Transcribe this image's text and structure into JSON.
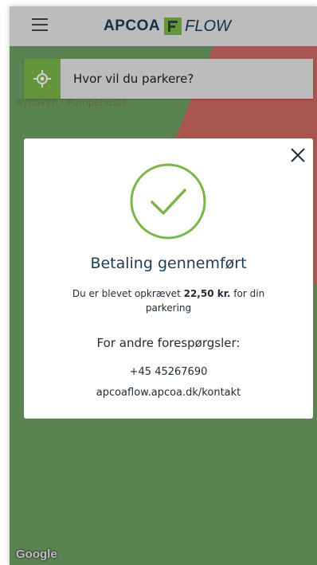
{
  "header": {
    "brand_left": "APCOA",
    "brand_right": "FLOW",
    "menu_icon": "hamburger-menu-icon",
    "brand_color": "#7ab648"
  },
  "search": {
    "placeholder": "Hvor vil du parkere?",
    "icon": "locate-crosshair-icon"
  },
  "map": {
    "street_label": "Byhaven - Pumpehuset",
    "attribution": "Google",
    "zone_colors": {
      "green": "#6f9f63",
      "red": "#cf6a63"
    }
  },
  "modal": {
    "title": "Betaling gennemført",
    "charged_prefix": "Du er blevet opkrævet ",
    "charged_amount": "22,50 kr.",
    "charged_suffix": " for din parkering",
    "inquiries_label": "For andre forespørgsler:",
    "phone": "+45 45267690",
    "website": "apcoaflow.apcoa.dk/kontakt",
    "success_icon": "check-circle-icon",
    "close_icon": "close-icon"
  }
}
